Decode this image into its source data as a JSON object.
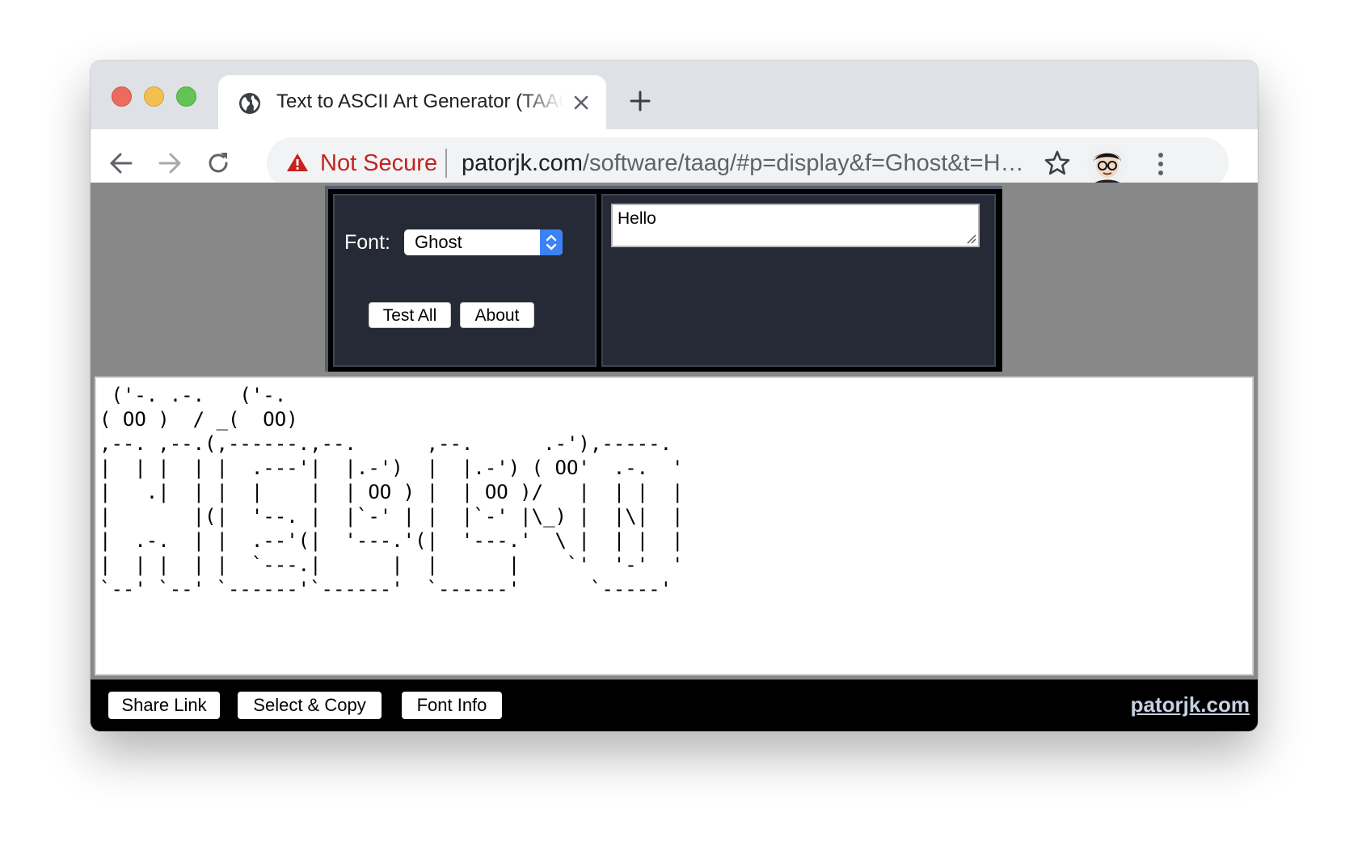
{
  "browser": {
    "tab_title": "Text to ASCII Art Generator (TAAG)",
    "security_label": "Not Secure",
    "url_host": "patorjk.com",
    "url_path": "/software/taag/#p=display&f=Ghost&t=Hello"
  },
  "controls": {
    "font_label": "Font:",
    "font_value": "Ghost",
    "test_all_label": "Test All",
    "about_label": "About",
    "input_text": "Hello"
  },
  "output": {
    "ascii_art": " ('-. .-.   ('-.                                                \n( OO )  / _(  OO)                                               \n,--. ,--.(,------.,--.      ,--.      .-'),-----.               \n|  | |  | |  .---'|  |.-')  |  |.-') ( OO'  .-.  '              \n|   .|  | |  |    |  | OO ) |  | OO )/   |  | |  |              \n|       |(|  '--. |  |`-' | |  |`-' |\\_) |  |\\|  |              \n|  .-.  | |  .--'(|  '---.'(|  '---.'  \\ |  | |  |              \n|  | |  | |  `---.|      |  |      |    `'  '-'  '              \n`--' `--' `------'`------'  `------'      `-----'               "
  },
  "footer": {
    "share_link_label": "Share Link",
    "select_copy_label": "Select & Copy",
    "font_info_label": "Font Info",
    "site_link": "patorjk.com"
  },
  "colors": {
    "panel_bg": "#262a37",
    "page_bg": "#888888",
    "footer_bg": "#000000",
    "select_accent": "#3b82f6",
    "not_secure_red": "#c5221f"
  },
  "icons": {
    "favicon": "globe-icon",
    "close": "close-icon",
    "new_tab": "plus-icon",
    "back": "arrow-left-icon",
    "forward": "arrow-right-icon",
    "reload": "reload-icon",
    "warning": "warning-triangle-icon",
    "bookmark": "star-icon",
    "profile": "avatar",
    "menu": "kebab-menu-icon"
  }
}
